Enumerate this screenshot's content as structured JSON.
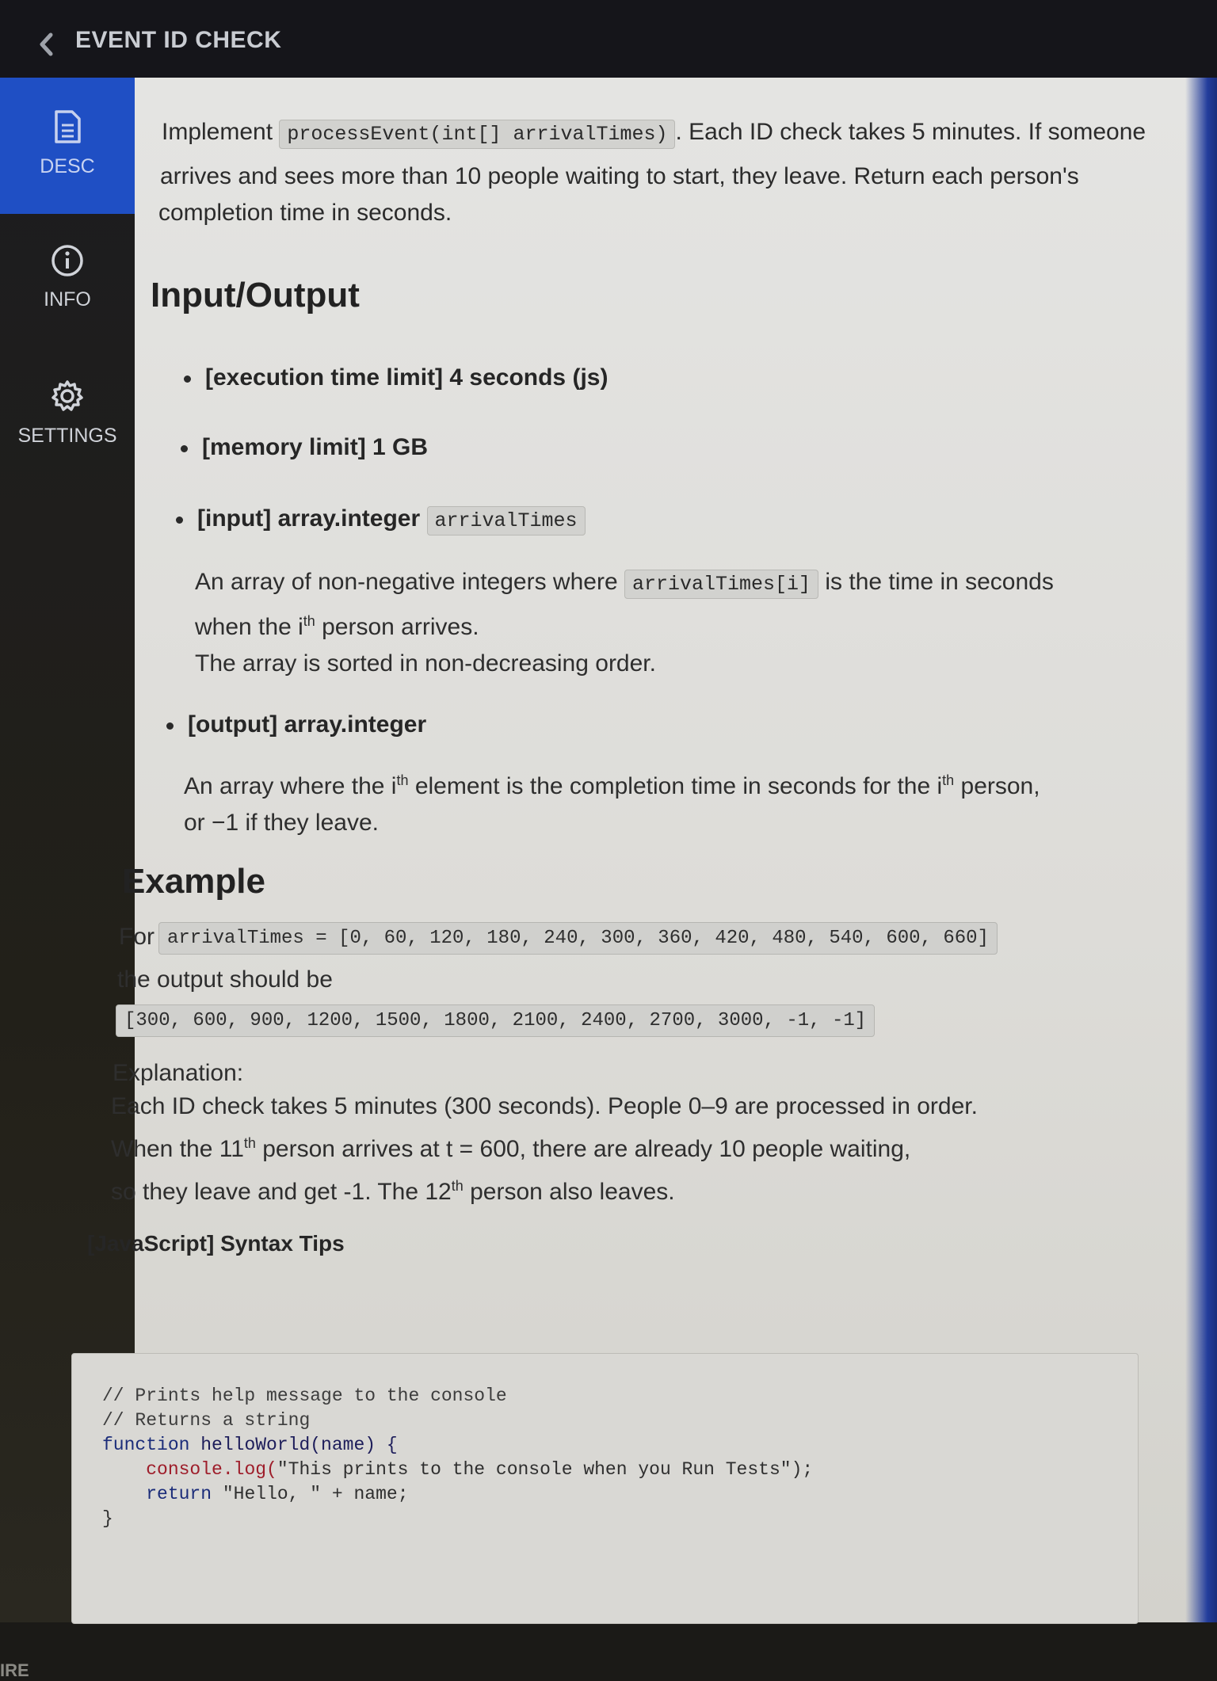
{
  "header": {
    "back_icon": "chevron-left-icon",
    "title": "EVENT ID CHECK"
  },
  "sidebar": {
    "items": [
      {
        "label": "DESC",
        "icon": "document-icon",
        "active": true
      },
      {
        "label": "INFO",
        "icon": "info-icon",
        "active": false
      },
      {
        "label": "SETTINGS",
        "icon": "gear-icon",
        "active": false
      }
    ]
  },
  "description": {
    "prefix": "Implement",
    "signature": "processEvent(int[] arrivalTimes)",
    "line1_rest": ". Each ID check takes 5 minutes. If someone",
    "line2": "arrives and sees more than 10 people waiting to start, they leave. Return each person's",
    "line3": "completion time in seconds."
  },
  "io": {
    "heading": "Input/Output",
    "exec_limit": "[execution time limit] 4 seconds (js)",
    "memory_limit": "[memory limit] 1 GB",
    "input_label": "[input] array.integer",
    "input_code": "arrivalTimes",
    "input_desc_a": "An array of non-negative integers where",
    "input_desc_code": "arrivalTimes[i]",
    "input_desc_b": "is the time in seconds",
    "input_desc_c1": "when the i",
    "input_desc_sup": "th",
    "input_desc_c2": " person arrives.",
    "input_desc_d": "The array is sorted in non-decreasing order.",
    "output_label": "[output] array.integer",
    "output_desc_a1": "An array where the i",
    "output_desc_sup1": "th",
    "output_desc_a2": " element is the completion time in seconds for the i",
    "output_desc_sup2": "th",
    "output_desc_a3": " person,",
    "output_desc_b": "or −1 if they leave."
  },
  "example": {
    "heading": "Example",
    "for_label": "For",
    "input_code": "arrivalTimes = [0, 60, 120, 180, 240, 300, 360, 420, 480, 540, 600, 660]",
    "output_label": "the output should be",
    "output_code": "[300, 600, 900, 1200, 1500, 1800, 2100, 2400, 2700, 3000, -1, -1]",
    "explanation_label": "Explanation:",
    "exp_line1": "Each ID check takes 5 minutes (300 seconds). People 0–9 are processed in order.",
    "exp_line2_a": "When the 11",
    "exp_line2_sup": "th",
    "exp_line2_b": " person arrives at t = 600, there are already 10 people waiting,",
    "exp_line3_a": "so they leave and get -1. The 12",
    "exp_line3_sup": "th",
    "exp_line3_b": " person also leaves."
  },
  "tips": {
    "heading": "[JavaScript] Syntax Tips",
    "c1": "// Prints help message to the console",
    "c2": "// Returns a string",
    "f_kw": "function",
    "f_name": "helloWorld(name) {",
    "l1_obj": "console.log(",
    "l1_str": "\"This prints to the console when you Run Tests\");",
    "l2_kw": "return",
    "l2_rest": "\"Hello, \" + name;",
    "close": "}"
  },
  "corner_text": "IRE"
}
